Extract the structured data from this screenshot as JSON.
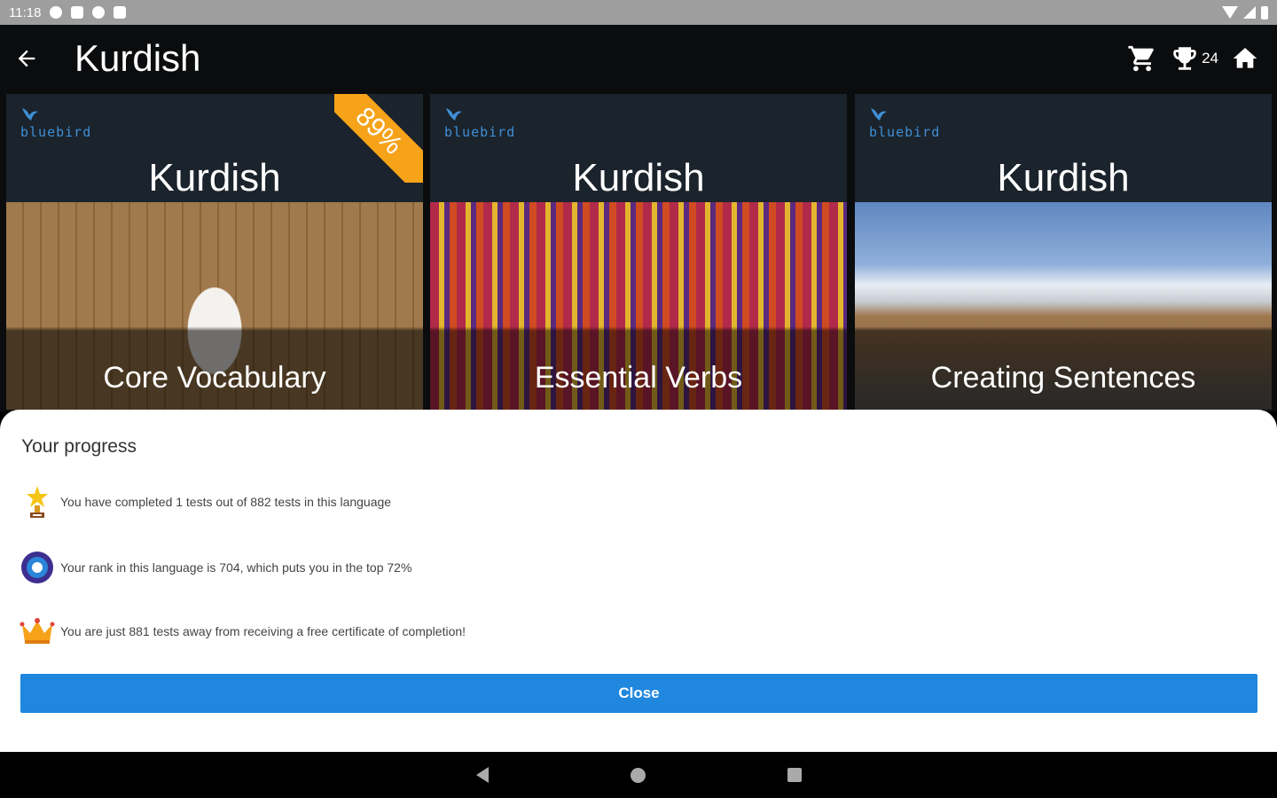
{
  "status_bar": {
    "time": "11:18"
  },
  "app_bar": {
    "title": "Kurdish",
    "trophy_count": "24"
  },
  "cards": [
    {
      "brand": "bluebird",
      "language": "Kurdish",
      "subtitle": "Core Vocabulary",
      "badge": "89%"
    },
    {
      "brand": "bluebird",
      "language": "Kurdish",
      "subtitle": "Essential Verbs"
    },
    {
      "brand": "bluebird",
      "language": "Kurdish",
      "subtitle": "Creating Sentences"
    }
  ],
  "progress": {
    "title": "Your progress",
    "items": [
      {
        "icon": "trophy-icon",
        "text": "You have completed 1 tests out of 882 tests in this language"
      },
      {
        "icon": "rank-medal-icon",
        "text": "Your rank in this language is 704, which puts you in the top 72%"
      },
      {
        "icon": "crown-icon",
        "text": "You are just 881 tests away from receiving a free certificate of completion!"
      }
    ],
    "close_label": "Close"
  },
  "colors": {
    "accent": "#1f87dd",
    "badge": "#f6a31a",
    "card_bg": "#1b232c",
    "brand": "#3f8fd6"
  }
}
